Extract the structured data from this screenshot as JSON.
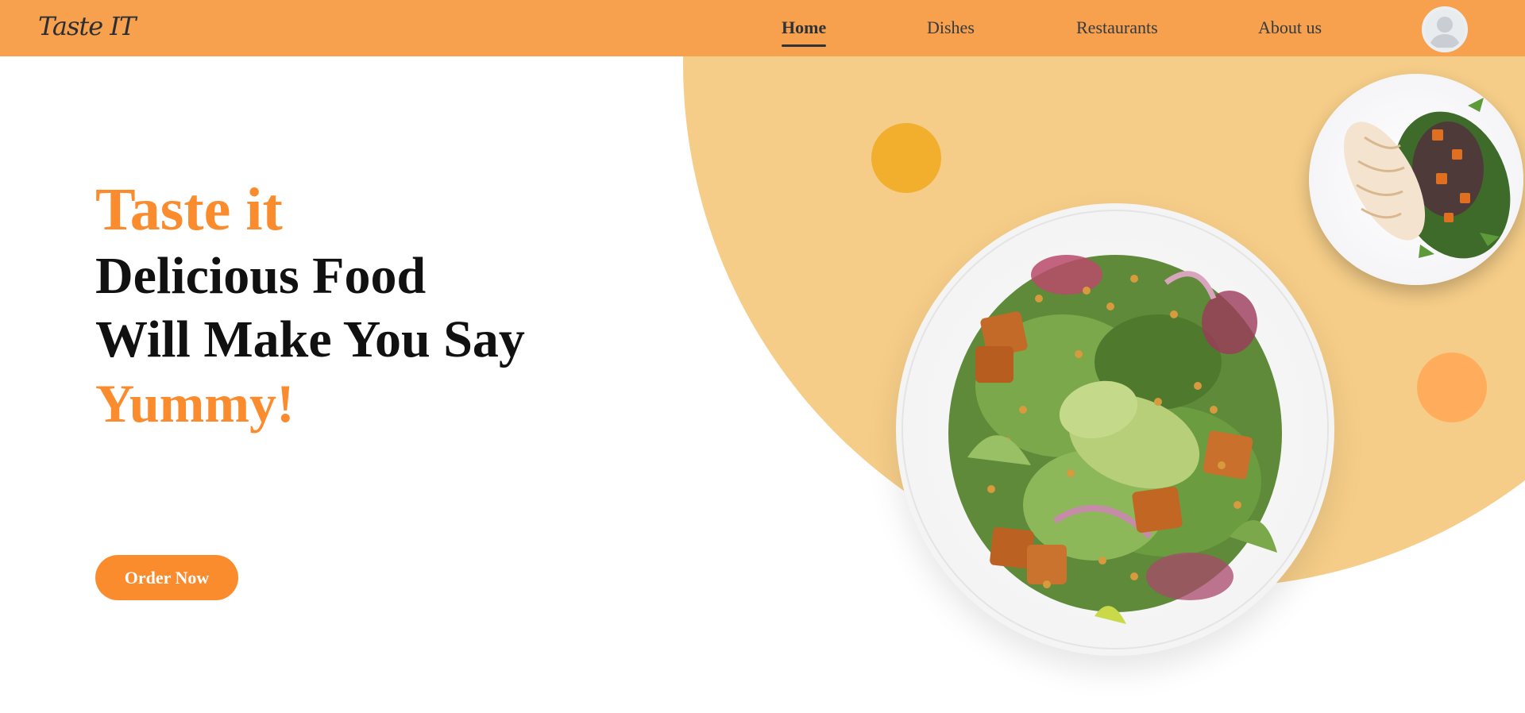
{
  "brand": {
    "logo_text": "Taste IT"
  },
  "nav": {
    "items": [
      {
        "label": "Home",
        "active": true
      },
      {
        "label": "Dishes",
        "active": false
      },
      {
        "label": "Restaurants",
        "active": false
      },
      {
        "label": "About us",
        "active": false
      }
    ],
    "avatar_icon": "user-avatar-icon"
  },
  "hero": {
    "line1": "Taste it",
    "line2": "Delicious Food",
    "line3": "Will Make You Say",
    "line4": "Yummy!",
    "cta_label": "Order Now"
  },
  "colors": {
    "header_bg": "#f7a04d",
    "accent_orange": "#fb8c2e",
    "hero_circle": "#f5cd88",
    "dot_gold": "#f2ae2d",
    "dot_orange": "#ffad5c"
  }
}
